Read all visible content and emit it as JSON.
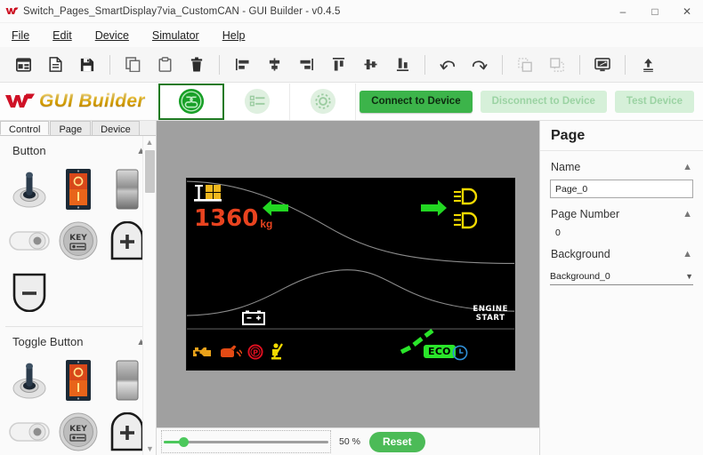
{
  "window": {
    "title": "Switch_Pages_SmartDisplay7via_CustomCAN - GUI Builder - v0.4.5",
    "app_icon": "w-logo-icon",
    "minimize": "–",
    "maximize": "□",
    "close": "✕"
  },
  "menu": [
    {
      "label": "File",
      "accel": "F"
    },
    {
      "label": "Edit",
      "accel": "E"
    },
    {
      "label": "Device",
      "accel": "D"
    },
    {
      "label": "Simulator",
      "accel": "S"
    },
    {
      "label": "Help",
      "accel": "H"
    }
  ],
  "toolbar": {
    "groups": [
      {
        "items": [
          {
            "name": "new-project-icon",
            "label": "New Project",
            "disabled": false
          },
          {
            "name": "new-page-icon",
            "label": "New Page",
            "disabled": false
          },
          {
            "name": "save-icon",
            "label": "Save",
            "disabled": false
          }
        ]
      },
      {
        "items": [
          {
            "name": "copy-icon",
            "label": "Copy",
            "disabled": false
          },
          {
            "name": "paste-icon",
            "label": "Paste",
            "disabled": false
          },
          {
            "name": "delete-icon",
            "label": "Delete",
            "disabled": false
          }
        ]
      },
      {
        "items": [
          {
            "name": "align-left-icon",
            "label": "Align Left",
            "disabled": false
          },
          {
            "name": "align-center-horizontal-icon",
            "label": "Align Center",
            "disabled": false
          },
          {
            "name": "align-right-icon",
            "label": "Align Right",
            "disabled": false
          },
          {
            "name": "align-top-icon",
            "label": "Align Top",
            "disabled": false
          },
          {
            "name": "align-middle-icon",
            "label": "Align Middle",
            "disabled": false
          },
          {
            "name": "align-bottom-icon",
            "label": "Align Bottom",
            "disabled": false
          }
        ]
      },
      {
        "items": [
          {
            "name": "undo-icon",
            "label": "Undo",
            "disabled": false
          },
          {
            "name": "redo-icon",
            "label": "Redo",
            "disabled": false
          }
        ]
      },
      {
        "items": [
          {
            "name": "bring-to-front-icon",
            "label": "Bring To Front",
            "disabled": true
          },
          {
            "name": "send-to-back-icon",
            "label": "Send To Back",
            "disabled": true
          }
        ]
      },
      {
        "items": [
          {
            "name": "preview-display-icon",
            "label": "Preview",
            "disabled": false
          }
        ]
      },
      {
        "items": [
          {
            "name": "upload-icon",
            "label": "Upload",
            "disabled": false
          }
        ]
      }
    ]
  },
  "brand": {
    "logo_icon": "w-logo-icon",
    "text": "GUI Builder"
  },
  "nav": [
    {
      "name": "nav-design-icon",
      "label": "Design",
      "active": true
    },
    {
      "name": "nav-list-icon",
      "label": "List",
      "active": false
    },
    {
      "name": "nav-settings-icon",
      "label": "Settings",
      "active": false
    }
  ],
  "device_actions": {
    "connect": "Connect to Device",
    "disconnect": "Disconnect to Device",
    "test": "Test Device"
  },
  "left_panel": {
    "tabs": [
      {
        "label": "Control",
        "active": true
      },
      {
        "label": "Page",
        "active": false
      },
      {
        "label": "Device",
        "active": false
      }
    ],
    "sections": [
      {
        "title": "Button",
        "collapse_icon": "chevron-up-icon",
        "items": [
          {
            "name": "toggle-switch-lever-thumb",
            "label": "Lever Toggle Switch"
          },
          {
            "name": "rocker-switch-thumb",
            "label": "Rocker Switch"
          },
          {
            "name": "slide-switch-thumb",
            "label": "Slide Switch"
          },
          {
            "name": "pill-toggle-thumb",
            "label": "Pill Toggle"
          },
          {
            "name": "key-button-thumb",
            "label": "Key Button"
          },
          {
            "name": "plus-button-thumb",
            "label": "Plus Button"
          },
          {
            "name": "minus-button-thumb",
            "label": "Minus Button"
          }
        ]
      },
      {
        "title": "Toggle Button",
        "collapse_icon": "chevron-up-icon",
        "items": [
          {
            "name": "toggle-switch-lever-thumb",
            "label": "Lever Toggle Switch"
          },
          {
            "name": "rocker-switch-thumb",
            "label": "Rocker Switch"
          },
          {
            "name": "slide-switch-thumb",
            "label": "Slide Switch"
          },
          {
            "name": "pill-toggle-thumb",
            "label": "Pill Toggle"
          },
          {
            "name": "key-button-thumb",
            "label": "Key Button"
          },
          {
            "name": "plus-button-thumb",
            "label": "Plus Button"
          }
        ]
      }
    ]
  },
  "canvas": {
    "background_color": "#a0a0a0",
    "display": {
      "background_color": "#000000",
      "load_value": "1360",
      "load_unit": "kg",
      "load_color": "#e8431f",
      "pallet_icon": "pallet-load-icon",
      "left_arrow_icon": "turn-signal-left-icon",
      "right_arrow_icon": "turn-signal-right-icon",
      "arrow_color": "#22d722",
      "high_beam_icon": "high-beam-icon",
      "low_beam_icon": "low-beam-icon",
      "beam_color": "#f2d900",
      "battery_icon": "battery-warning-icon",
      "engine_start_line1": "ENGINE",
      "engine_start_line2": "START",
      "eco_label": "ECO",
      "eco_color": "#2ae52a",
      "clock_icon": "clock-icon",
      "clock_color": "#2f8fd6",
      "telltales": [
        {
          "name": "check-engine-icon",
          "label": "Check Engine",
          "color": "#eaa21a"
        },
        {
          "name": "oil-pressure-icon",
          "label": "Oil Pressure",
          "color": "#e34a14"
        },
        {
          "name": "parking-brake-icon",
          "label": "Parking Brake",
          "color": "#e01020"
        },
        {
          "name": "seatbelt-icon",
          "label": "Seat Belt",
          "color": "#f2d900"
        }
      ]
    }
  },
  "zoombar": {
    "percent": "50 %",
    "value": 50,
    "reset_label": "Reset"
  },
  "right_panel": {
    "title": "Page",
    "name_section": {
      "label": "Name",
      "collapse_icon": "chevron-up-icon",
      "value": "Page_0"
    },
    "page_number_section": {
      "label": "Page Number",
      "collapse_icon": "chevron-up-icon",
      "value": "0"
    },
    "background_section": {
      "label": "Background",
      "collapse_icon": "chevron-up-icon",
      "value": "Background_0",
      "caret_icon": "caret-down-icon"
    }
  }
}
